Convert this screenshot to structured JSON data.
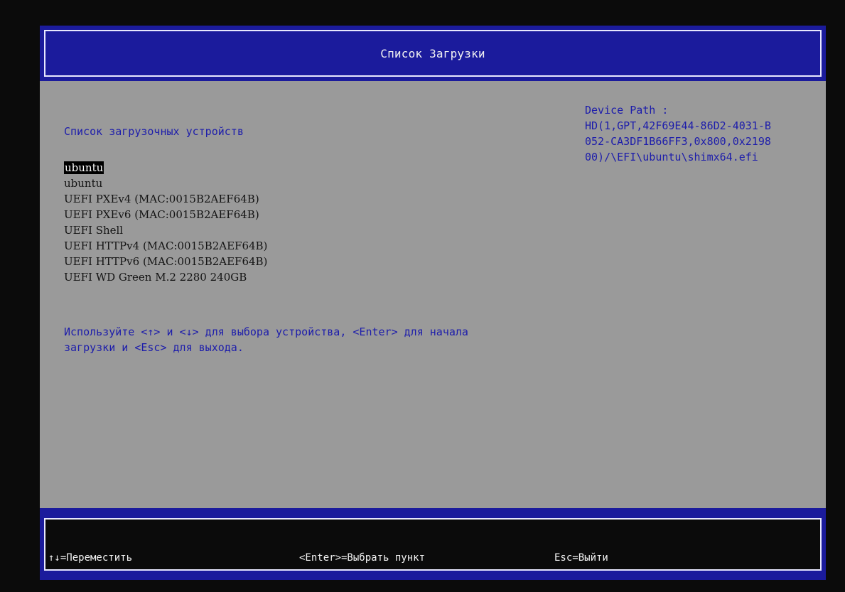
{
  "header": {
    "title": "Список Загрузки"
  },
  "main": {
    "heading": "Список загрузочных устройств",
    "devices": [
      "ubuntu",
      "ubuntu",
      "UEFI PXEv4 (MAC:0015B2AEF64B)",
      "UEFI PXEv6 (MAC:0015B2AEF64B)",
      "UEFI Shell",
      "UEFI HTTPv4 (MAC:0015B2AEF64B)",
      "UEFI HTTPv6 (MAC:0015B2AEF64B)",
      "UEFI WD Green M.2 2280 240GB"
    ],
    "selected_index": 0,
    "help_line1": "Используйте <↑> и <↓> для выбора устройства, <Enter> для начала",
    "help_line2": "загрузки и <Esc> для выхода."
  },
  "device_path": {
    "line1": "Device Path :",
    "line2": "HD(1,GPT,42F69E44-86D2-4031-B",
    "line3": "052-CA3DF1B66FF3,0x800,0x2198",
    "line4": "00)/\\EFI\\ubuntu\\shimx64.efi"
  },
  "footer": {
    "move": "↑↓=Переместить",
    "select": "<Enter>=Выбрать пункт",
    "exit": "Esc=Выйти"
  },
  "colors": {
    "background": "#9a9a9a",
    "bar_blue": "#1b1b9c",
    "text_blue": "#1d1dab",
    "selection_bg": "#000000"
  }
}
